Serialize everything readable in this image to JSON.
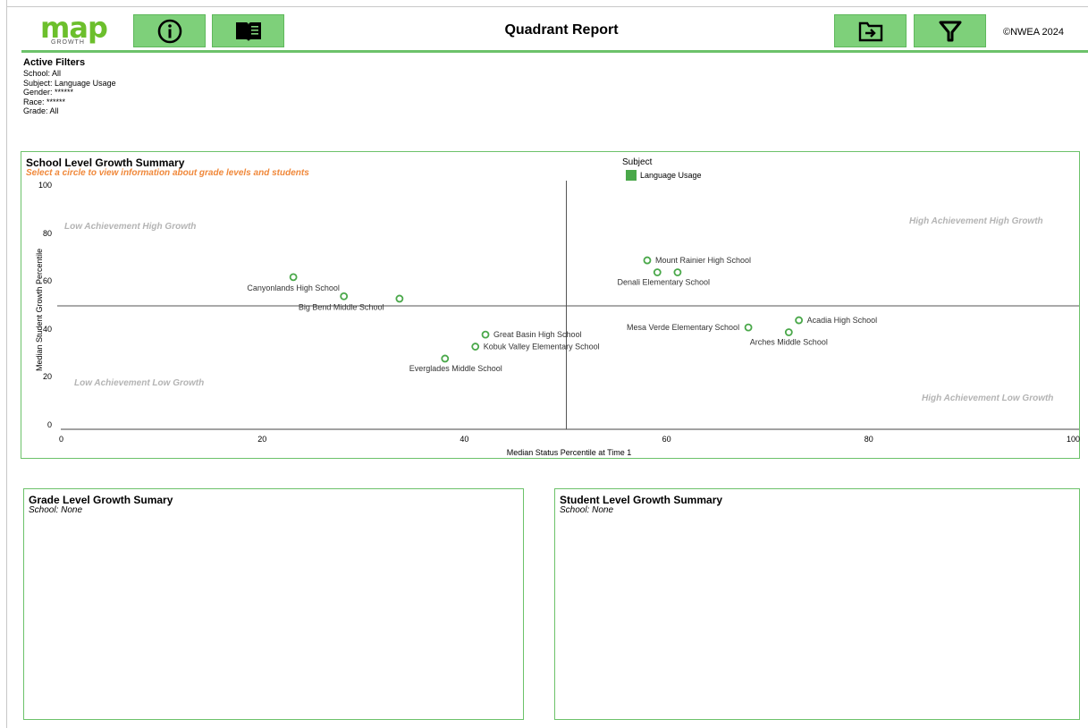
{
  "header": {
    "logo_text": "map",
    "logo_subtext": "GROWTH",
    "title": "Quadrant Report",
    "copyright": "©NWEA 2024",
    "icons": [
      "info-icon",
      "book-icon",
      "export-icon",
      "filter-icon"
    ]
  },
  "filters": {
    "title": "Active Filters",
    "school": "School: All",
    "subject": "Subject: Language Usage",
    "gender": "Gender: ******",
    "race": "Race: ******",
    "grade": "Grade: All"
  },
  "school_panel": {
    "title": "School Level Growth Summary",
    "hint": "Select a circle to view information about grade levels and students",
    "legend_title": "Subject",
    "legend_label": "Language Usage",
    "quadrants": {
      "tl": "Low Achievement High Growth",
      "tr": "High Achievement High Growth",
      "bl": "Low Achievement Low Growth",
      "br": "High Achievement Low Growth"
    }
  },
  "grade_panel": {
    "title": "Grade Level Growth Sumary",
    "subtitle": "School: None"
  },
  "student_panel": {
    "title": "Student Level Growth Summary",
    "subtitle": "School: None"
  },
  "colors": {
    "accent": "#6cc26a",
    "button": "#7ed07a",
    "hint": "#f0883a",
    "point": "#4aa84a"
  },
  "chart_data": {
    "type": "scatter",
    "xlabel": "Median Status Percentile at Time 1",
    "ylabel": "Median Student Growth Percentile",
    "xlim": [
      0,
      100
    ],
    "ylim": [
      0,
      100
    ],
    "x_ticks": [
      0,
      20,
      40,
      60,
      80,
      100
    ],
    "y_ticks": [
      0,
      20,
      40,
      60,
      80,
      100
    ],
    "quadrant_split": {
      "x": 50,
      "y": 50
    },
    "series": [
      {
        "name": "Language Usage",
        "points": [
          {
            "label": "Canyonlands High School",
            "x": 23,
            "y": 62
          },
          {
            "label": "Big Bend Middle School",
            "x": 28,
            "y": 54
          },
          {
            "label": "",
            "x": 33.5,
            "y": 53
          },
          {
            "label": "Great Basin High School",
            "x": 42,
            "y": 38
          },
          {
            "label": "Kobuk Valley Elementary School",
            "x": 41,
            "y": 33
          },
          {
            "label": "Everglades Middle School",
            "x": 38,
            "y": 28
          },
          {
            "label": "Mount Rainier High School",
            "x": 58,
            "y": 69
          },
          {
            "label": "Denali Elementary School",
            "x": 59,
            "y": 64
          },
          {
            "label": "",
            "x": 61,
            "y": 64
          },
          {
            "label": "Mesa Verde Elementary School",
            "x": 68,
            "y": 41
          },
          {
            "label": "Acadia High School",
            "x": 73,
            "y": 44
          },
          {
            "label": "Arches Middle School",
            "x": 72,
            "y": 39
          }
        ]
      }
    ]
  }
}
